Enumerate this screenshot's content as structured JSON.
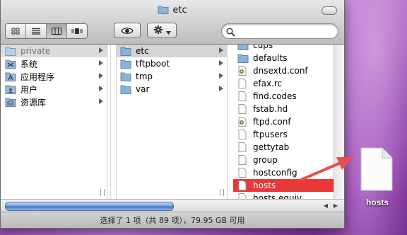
{
  "window": {
    "title": "etc",
    "view_buttons": [
      "icon-view",
      "list-view",
      "column-view",
      "coverflow-view"
    ],
    "active_view": 2,
    "search": {
      "value": "",
      "placeholder": ""
    }
  },
  "sidebar": {
    "items": [
      {
        "label": "private",
        "icon": "folder-icon",
        "state": "grey"
      },
      {
        "label": "系统",
        "icon": "system-icon"
      },
      {
        "label": "应用程序",
        "icon": "applications-icon"
      },
      {
        "label": "用户",
        "icon": "users-icon"
      },
      {
        "label": "资源库",
        "icon": "library-icon"
      }
    ]
  },
  "column2": {
    "items": [
      {
        "label": "etc",
        "icon": "folder-icon",
        "state": "grey"
      },
      {
        "label": "tftpboot",
        "icon": "folder-icon"
      },
      {
        "label": "tmp",
        "icon": "folder-icon"
      },
      {
        "label": "var",
        "icon": "folder-icon"
      }
    ]
  },
  "column3": {
    "items": [
      {
        "label": "cups",
        "icon": "folder-icon"
      },
      {
        "label": "defaults",
        "icon": "folder-icon"
      },
      {
        "label": "dnsextd.conf",
        "icon": "config-file-icon"
      },
      {
        "label": "efax.rc",
        "icon": "file-icon"
      },
      {
        "label": "find.codes",
        "icon": "file-icon"
      },
      {
        "label": "fstab.hd",
        "icon": "file-icon"
      },
      {
        "label": "ftpd.conf",
        "icon": "config-file-icon"
      },
      {
        "label": "ftpusers",
        "icon": "file-icon"
      },
      {
        "label": "gettytab",
        "icon": "file-icon"
      },
      {
        "label": "group",
        "icon": "file-icon"
      },
      {
        "label": "hostconfig",
        "icon": "file-icon"
      },
      {
        "label": "hosts",
        "icon": "file-icon",
        "state": "selected"
      },
      {
        "label": "hosts.equiv",
        "icon": "file-icon"
      }
    ]
  },
  "status": {
    "text": "选择了 1 项（共 89 项），79.95 GB 可用"
  },
  "desktop": {
    "file_label": "hosts"
  },
  "colors": {
    "selection": "#e83838",
    "arrow": "#e8504f"
  }
}
